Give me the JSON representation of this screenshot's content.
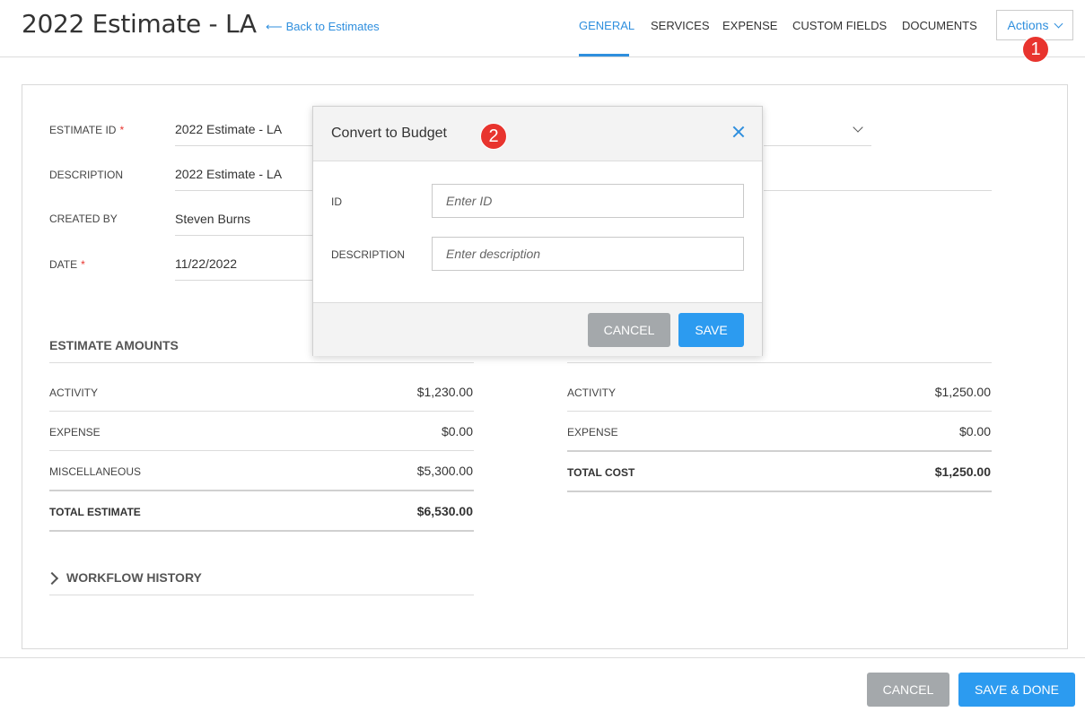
{
  "header": {
    "title": "2022 Estimate - LA",
    "back_link": "Back to Estimates",
    "tabs": [
      "GENERAL",
      "SERVICES",
      "EXPENSE",
      "CUSTOM FIELDS",
      "DOCUMENTS"
    ],
    "active_tab": "GENERAL",
    "actions_label": "Actions"
  },
  "badges": [
    "1",
    "2"
  ],
  "form": {
    "estimate_id": {
      "label": "ESTIMATE ID",
      "value": "2022  Estimate - LA"
    },
    "description": {
      "label": "DESCRIPTION",
      "value": "2022 Estimate - LA"
    },
    "created_by": {
      "label": "CREATED BY",
      "value": "Steven Burns"
    },
    "date": {
      "label": "DATE",
      "value": "11/22/2022"
    },
    "required_mark": "*"
  },
  "estimate_amounts": {
    "title": "ESTIMATE AMOUNTS",
    "rows": [
      {
        "label": "ACTIVITY",
        "value": "$1,230.00"
      },
      {
        "label": "EXPENSE",
        "value": "$0.00"
      },
      {
        "label": "MISCELLANEOUS",
        "value": "$5,300.00"
      }
    ],
    "total": {
      "label": "TOTAL ESTIMATE",
      "value": "$6,530.00"
    }
  },
  "cost_amounts": {
    "rows": [
      {
        "label": "ACTIVITY",
        "value": "$1,250.00"
      },
      {
        "label": "EXPENSE",
        "value": "$0.00"
      }
    ],
    "total": {
      "label": "TOTAL COST",
      "value": "$1,250.00"
    }
  },
  "workflow": {
    "title": "WORKFLOW HISTORY"
  },
  "modal": {
    "title": "Convert to Budget",
    "id_label": "ID",
    "id_placeholder": "Enter ID",
    "description_label": "DESCRIPTION",
    "description_placeholder": "Enter description",
    "cancel": "CANCEL",
    "save": "SAVE"
  },
  "footer": {
    "cancel": "CANCEL",
    "save_done": "SAVE & DONE"
  },
  "colors": {
    "accent": "#2f8fde",
    "badge": "#e8342e",
    "button_blue": "#2c9bf0",
    "button_gray": "#a4a8ab"
  }
}
